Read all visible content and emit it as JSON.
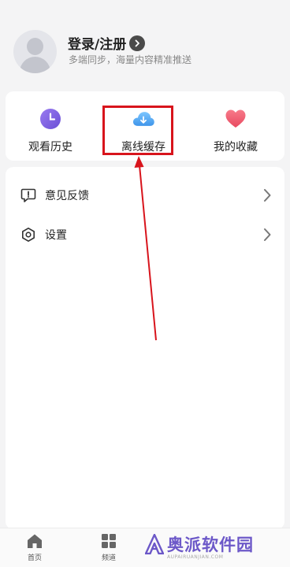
{
  "header": {
    "login_title": "登录/注册",
    "login_subtitle": "多端同步，海量内容精准推送"
  },
  "quick_actions": [
    {
      "label": "观看历史",
      "icon": "clock-icon",
      "color": "#7b5ee0"
    },
    {
      "label": "离线缓存",
      "icon": "cloud-download-icon",
      "color": "#4aa3ef"
    },
    {
      "label": "我的收藏",
      "icon": "heart-icon",
      "color": "#ef5a6e"
    }
  ],
  "menu": [
    {
      "label": "意见反馈",
      "icon": "feedback-icon"
    },
    {
      "label": "设置",
      "icon": "settings-gear-icon"
    }
  ],
  "bottom_nav": [
    {
      "label": "首页",
      "icon": "home-icon"
    },
    {
      "label": "频道",
      "icon": "grid-icon"
    }
  ],
  "watermark": {
    "text": "奥派软件园",
    "sub": "AUPAIRUANJIAN.COM"
  },
  "annotation": {
    "color": "#d8141c"
  }
}
